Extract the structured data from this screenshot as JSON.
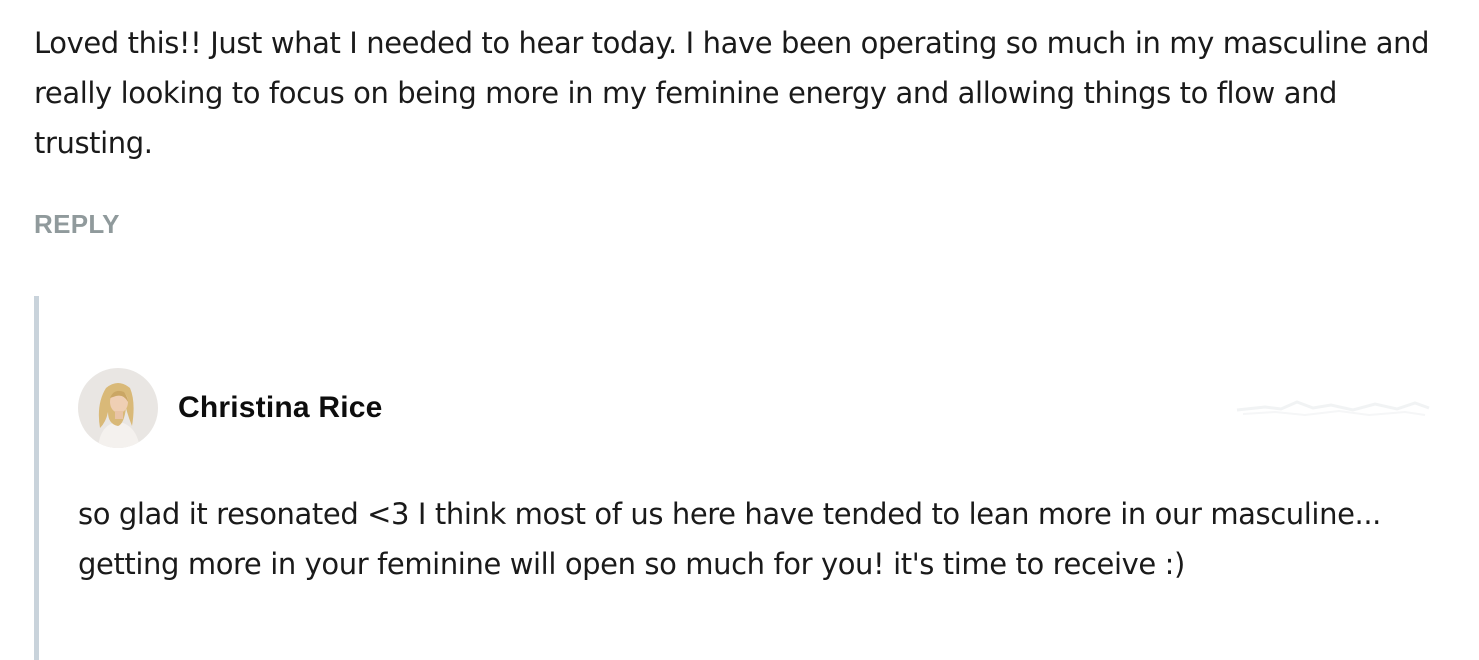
{
  "comment": {
    "text": "Loved this!! Just what I needed to hear today. I have been operating so much in my masculine and really looking to focus on being more in my feminine energy and allowing things to flow and trusting.",
    "reply_label": "REPLY"
  },
  "reply": {
    "author": {
      "name": "Christina Rice"
    },
    "text": "so glad it resonated <3 I think most of us here have tended to lean more in our masculine... getting more in your feminine will open so much for you! it's time to receive :)"
  },
  "colors": {
    "text": "#1a1a1a",
    "reply_link": "#909a9c",
    "thread_border": "#c9d3db"
  }
}
